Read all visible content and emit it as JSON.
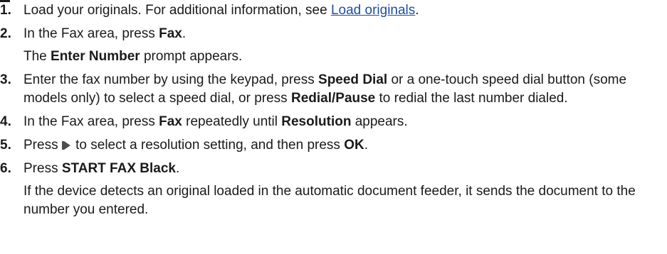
{
  "steps": [
    {
      "number": "1.",
      "text_1": "Load your originals. For additional information, see ",
      "link": "Load originals",
      "text_2": "."
    },
    {
      "number": "2.",
      "text_1": "In the Fax area, press ",
      "bold_1": "Fax",
      "text_2": ".",
      "sub_1": "The ",
      "sub_bold": "Enter Number",
      "sub_2": " prompt appears."
    },
    {
      "number": "3.",
      "text_1": "Enter the fax number by using the keypad, press ",
      "bold_1": "Speed Dial",
      "text_2": " or a one-touch speed dial button (some models only) to select a speed dial, or press ",
      "bold_2": "Redial/Pause",
      "text_3": " to redial the last number dialed."
    },
    {
      "number": "4.",
      "text_1": "In the Fax area, press ",
      "bold_1": "Fax",
      "text_2": " repeatedly until ",
      "bold_2": "Resolution",
      "text_3": " appears."
    },
    {
      "number": "5.",
      "text_1": "Press ",
      "icon": "right-arrow-icon",
      "text_2": " to select a resolution setting, and then press ",
      "bold_1": "OK",
      "text_3": "."
    },
    {
      "number": "6.",
      "text_1": "Press ",
      "bold_1": "START FAX Black",
      "text_2": ".",
      "sub_1": "If the device detects an original loaded in the automatic document feeder, it sends the document to the number you entered."
    }
  ]
}
